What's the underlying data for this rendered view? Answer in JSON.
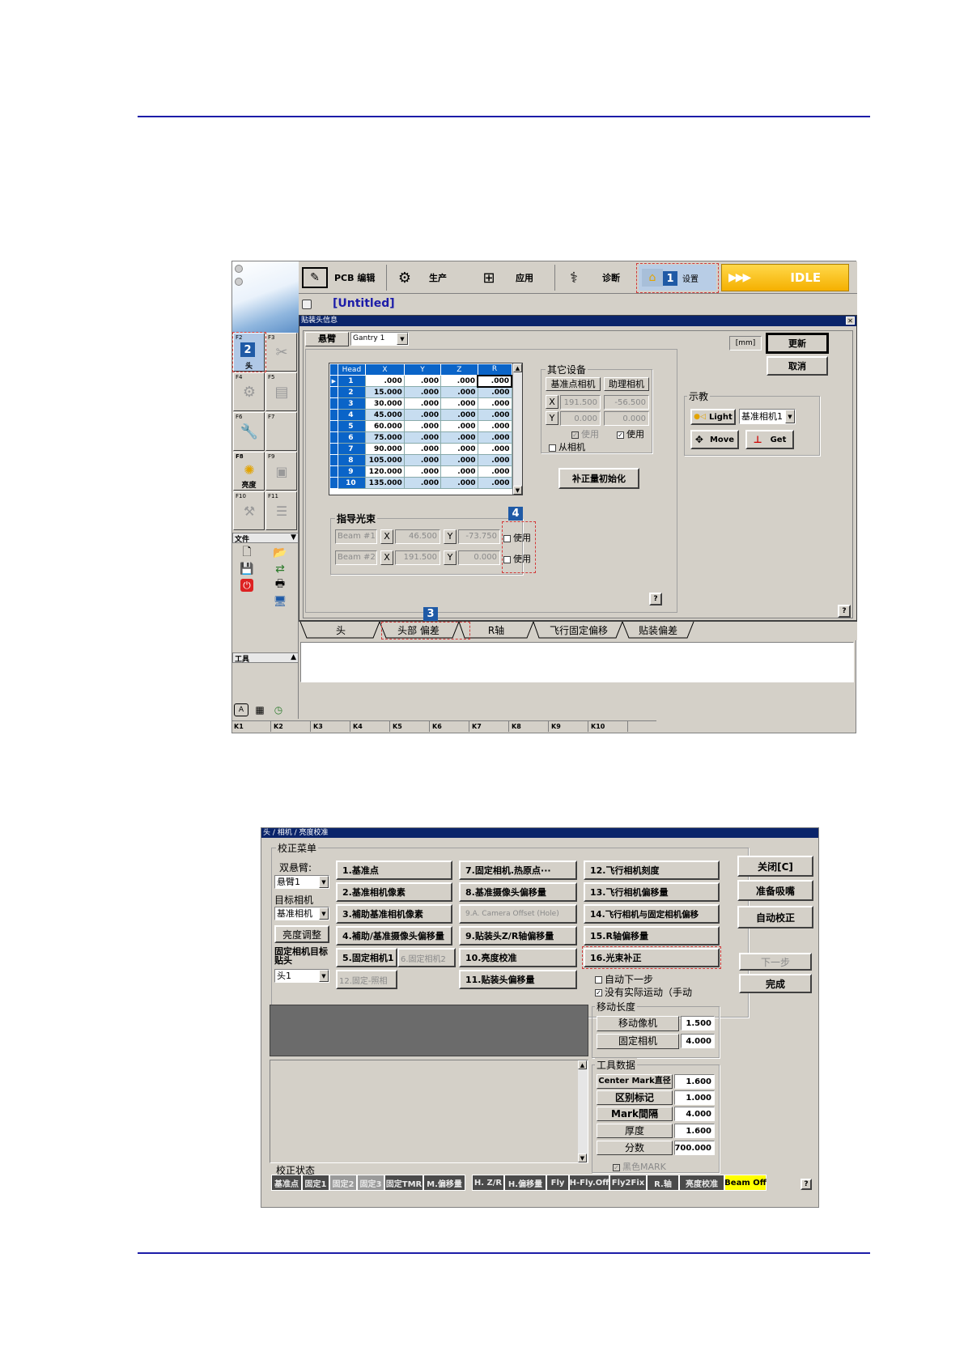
{
  "top_window": {
    "toolbar": [
      {
        "label": "PCB 编辑",
        "icon": "pcb-edit-icon"
      },
      {
        "label": "生产",
        "icon": "production-icon"
      },
      {
        "label": "应用",
        "icon": "application-icon"
      },
      {
        "label": "诊断",
        "icon": "diagnostics-icon"
      },
      {
        "label": "设置",
        "icon": "settings-icon"
      }
    ],
    "idle_label": "IDLE",
    "doc_title": "[Untitled]",
    "dialog_title": "贴装头信息",
    "gantry_label": "悬臂",
    "gantry_value": "Gantry 1",
    "unit_label": "[mm]",
    "update_button": "更新",
    "cancel_button": "取消",
    "teach": {
      "title": "示教",
      "light": "Light",
      "camera_select": "基准相机1",
      "move": "Move",
      "get": "Get"
    },
    "other_devices": {
      "title": "其它设备",
      "col_ref_cam": "基准点相机",
      "col_aux_cam": "助理相机",
      "x_ref": "191.500",
      "x_aux": "-56.500",
      "y_ref": "0.000",
      "y_aux": "0.000",
      "use_ref": "使用",
      "use_aux": "使用",
      "slave_cam": "从相机"
    },
    "init_offset_button": "补正量初始化",
    "head_table": {
      "columns": [
        "Head",
        "X",
        "Y",
        "Z",
        "R"
      ],
      "rows": [
        [
          "1",
          ".000",
          ".000",
          ".000",
          ".000"
        ],
        [
          "2",
          "15.000",
          ".000",
          ".000",
          ".000"
        ],
        [
          "3",
          "30.000",
          ".000",
          ".000",
          ".000"
        ],
        [
          "4",
          "45.000",
          ".000",
          ".000",
          ".000"
        ],
        [
          "5",
          "60.000",
          ".000",
          ".000",
          ".000"
        ],
        [
          "6",
          "75.000",
          ".000",
          ".000",
          ".000"
        ],
        [
          "7",
          "90.000",
          ".000",
          ".000",
          ".000"
        ],
        [
          "8",
          "105.000",
          ".000",
          ".000",
          ".000"
        ],
        [
          "9",
          "120.000",
          ".000",
          ".000",
          ".000"
        ],
        [
          "10",
          "135.000",
          ".000",
          ".000",
          ".000"
        ]
      ]
    },
    "guide_beam": {
      "title": "指导光束",
      "beams": [
        {
          "name": "Beam #1",
          "x": "46.500",
          "y": "-73.750",
          "use": "使用"
        },
        {
          "name": "Beam #2",
          "x": "191.500",
          "y": "0.000",
          "use": "使用"
        }
      ]
    },
    "help": "?",
    "tabs": [
      "头",
      "头部 偏差",
      "R轴",
      "飞行固定偏移",
      "贴装偏差"
    ],
    "sidebar": {
      "fkeys": [
        {
          "key": "F2",
          "label": "头"
        },
        {
          "key": "F3",
          "label": ""
        },
        {
          "key": "F4",
          "label": ""
        },
        {
          "key": "F5",
          "label": ""
        },
        {
          "key": "F6",
          "label": ""
        },
        {
          "key": "F7",
          "label": ""
        },
        {
          "key": "F8",
          "label": "亮度"
        },
        {
          "key": "F9",
          "label": ""
        },
        {
          "key": "F10",
          "label": ""
        },
        {
          "key": "F11",
          "label": ""
        }
      ],
      "file_label": "文件",
      "tools_label": "工具"
    },
    "bottom_keys": [
      "K1",
      "K2",
      "K3",
      "K4",
      "K5",
      "K6",
      "K7",
      "K8",
      "K9",
      "K10"
    ],
    "callouts": [
      "1",
      "2",
      "3",
      "4"
    ]
  },
  "bottom_window": {
    "title": "头 / 相机 / 亮度校准",
    "menu_title": "校正菜单",
    "dual_gantry_label": "双悬臂:",
    "gantry_select": "悬臂1",
    "target_camera_label": "目标相机",
    "target_camera_select": "基准相机",
    "brightness_button": "亮度调整",
    "fixed_cam_target_label": "固定相机目标贴头",
    "head_select": "头1",
    "col1": [
      "1.基准点",
      "2.基准相机像素",
      "3.補助基准相机像素",
      "4.補助/基准摄像头偏移量",
      "5.固定相机1",
      "6.固定相机2",
      "12.固定-照相"
    ],
    "col2": [
      "7.固定相机.热原点···",
      "8.基准摄像头偏移量",
      "9.A. Camera Offset (Hole)",
      "9.贴装头Z/R轴偏移量",
      "10.亮度校准",
      "11.贴装头偏移量"
    ],
    "col3": [
      "12.飞行相机刻度",
      "13.飞行相机偏移量",
      "14.飞行相机与固定相机偏移",
      "15.R轴偏移量",
      "16.光束补正"
    ],
    "close_button": "关闭[C]",
    "prepare_nozzle_button": "准备吸嘴",
    "auto_calib_button": "自动校正",
    "next_button": "下一步",
    "done_button": "完成",
    "auto_next": "自动下一步",
    "no_motion": "没有实际运动（手动",
    "move_length": {
      "title": "移动长度",
      "rows": [
        {
          "label": "移动像机",
          "value": "1.500"
        },
        {
          "label": "固定相机",
          "value": "4.000"
        }
      ]
    },
    "tool_data": {
      "title": "工具数据",
      "rows": [
        {
          "label": "Center Mark直径",
          "value": "1.600"
        },
        {
          "label": "区别标记",
          "value": "1.000"
        },
        {
          "label": "Mark間隔",
          "value": "4.000"
        },
        {
          "label": "厚度",
          "value": "1.600"
        },
        {
          "label": "分数",
          "value": "700.000"
        }
      ]
    },
    "black_mark": "黑色MARK",
    "status_title": "校正状态",
    "status": [
      {
        "label": "基准点",
        "bg": "#5a5a5a"
      },
      {
        "label": "固定1",
        "bg": "#5a5a5a"
      },
      {
        "label": "固定2",
        "bg": "#9a9a9a"
      },
      {
        "label": "固定3",
        "bg": "#9a9a9a"
      },
      {
        "label": "固定TMR",
        "bg": "#5a5a5a"
      },
      {
        "label": "M.偏移量",
        "bg": "#5a5a5a"
      },
      {
        "label": "H. Z/R",
        "bg": "#5a5a5a"
      },
      {
        "label": "H.偏移量",
        "bg": "#5a5a5a"
      },
      {
        "label": "Fly",
        "bg": "#5a5a5a"
      },
      {
        "label": "H-Fly.Off",
        "bg": "#5a5a5a"
      },
      {
        "label": "Fly2Fix",
        "bg": "#5a5a5a"
      },
      {
        "label": "R.轴",
        "bg": "#5a5a5a"
      },
      {
        "label": "亮度校准",
        "bg": "#5a5a5a"
      },
      {
        "label": "Beam Off",
        "bg": "#ffff00"
      }
    ],
    "help": "?"
  },
  "colors": {
    "accent": "#1c1ca8",
    "table_header": "#0a64c8",
    "table_alt": "#c7ddf0",
    "idle": "#f5b800",
    "callout": "#1f5aa6",
    "highlight": "#d23a3a"
  }
}
